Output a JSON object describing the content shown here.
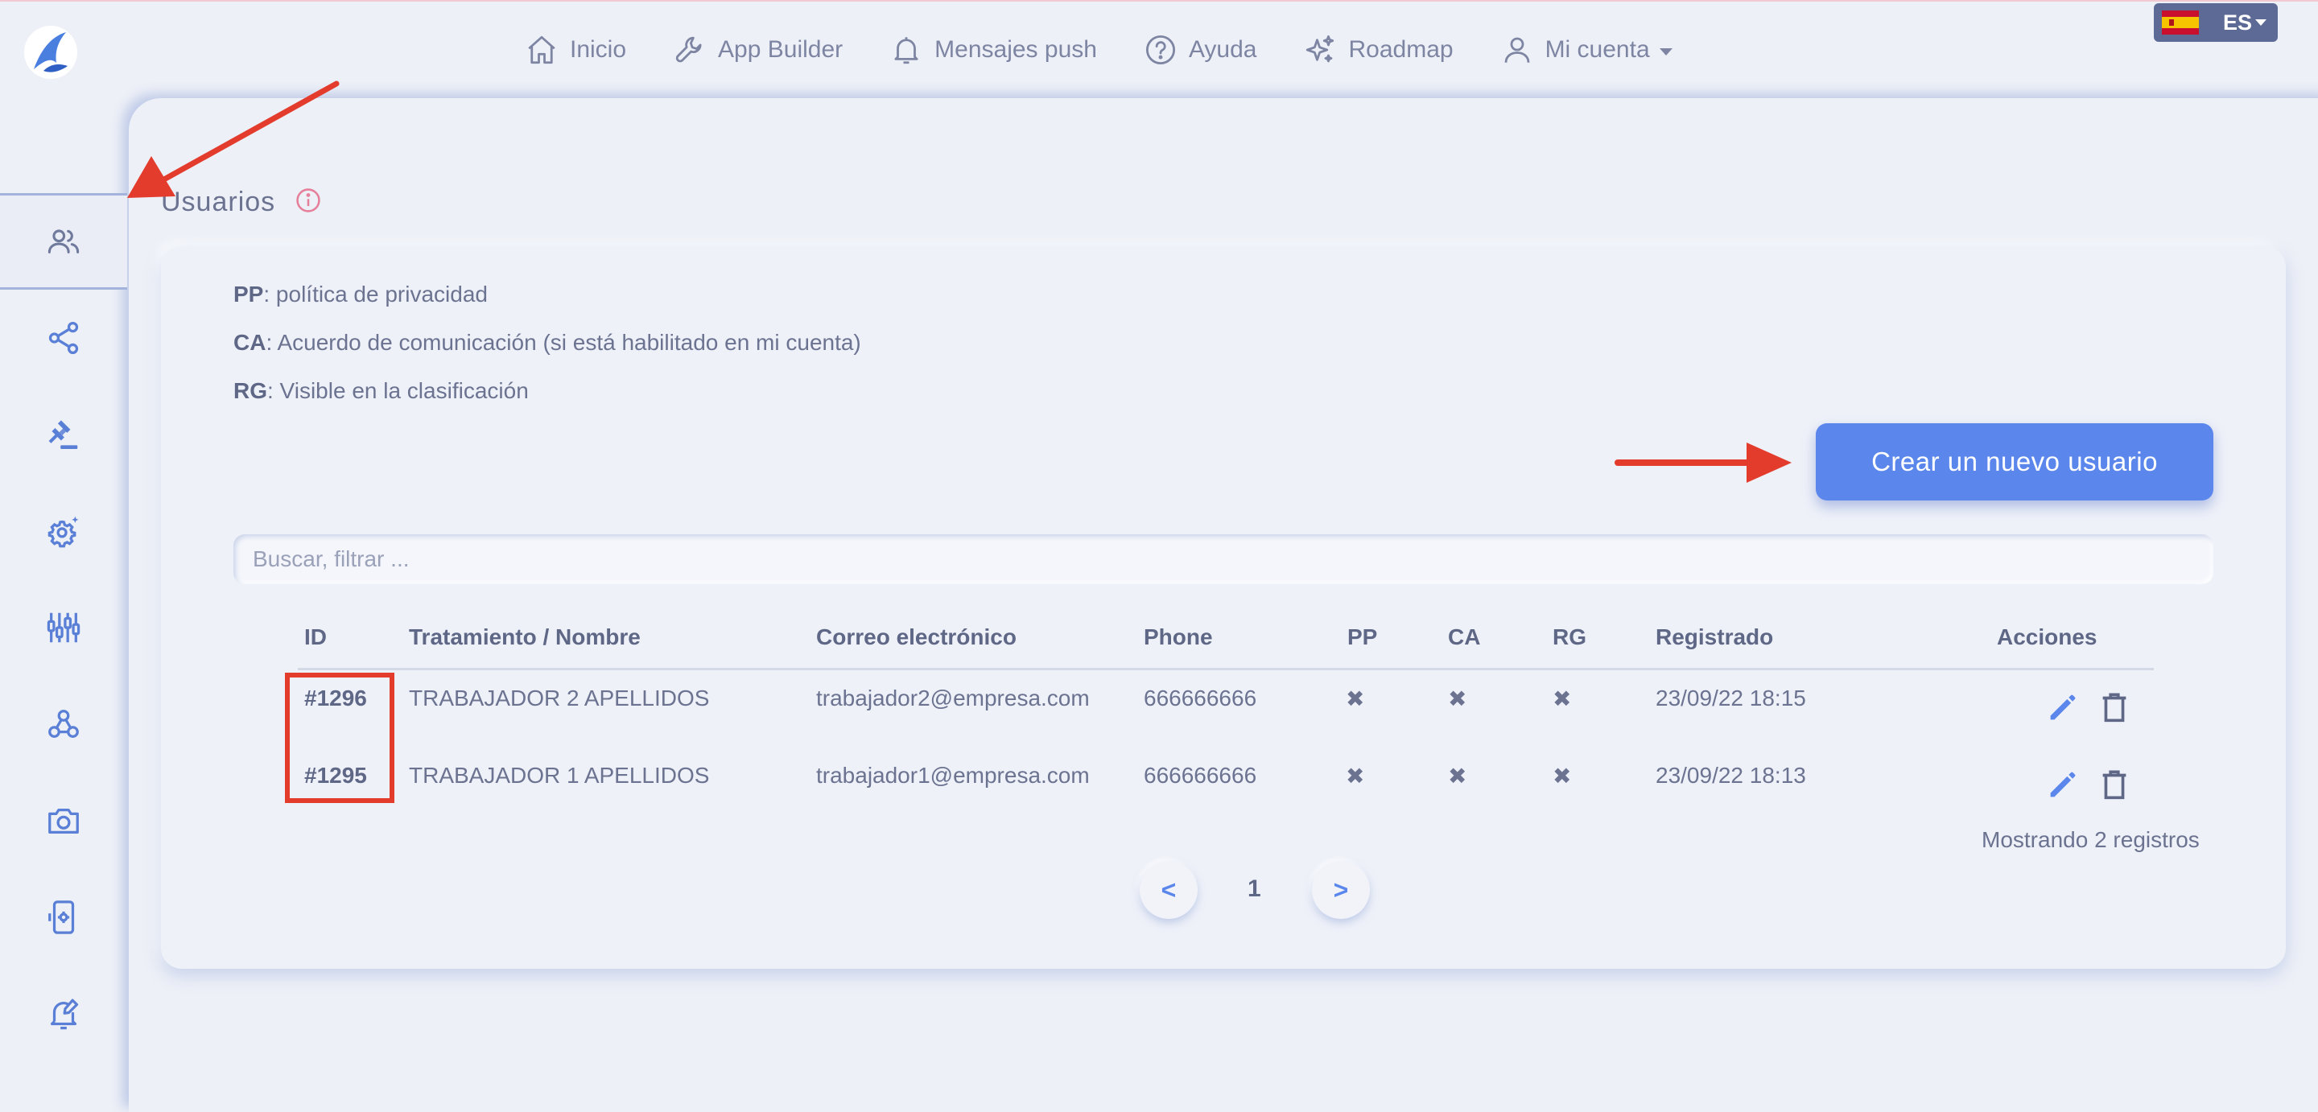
{
  "nav": {
    "items": [
      {
        "label": "Inicio",
        "icon": "home-icon"
      },
      {
        "label": "App Builder",
        "icon": "wrench-icon"
      },
      {
        "label": "Mensajes push",
        "icon": "bell-icon"
      },
      {
        "label": "Ayuda",
        "icon": "help-circle-icon"
      },
      {
        "label": "Roadmap",
        "icon": "sparkles-icon"
      },
      {
        "label": "Mi cuenta",
        "icon": "user-icon"
      }
    ],
    "language": "ES"
  },
  "sidebar": {
    "items": [
      {
        "icon": "users-icon",
        "active": true
      },
      {
        "icon": "share-icon"
      },
      {
        "icon": "gavel-icon"
      },
      {
        "icon": "gear-sparkle-icon"
      },
      {
        "icon": "sliders-icon"
      },
      {
        "icon": "webhook-icon"
      },
      {
        "icon": "camera-icon"
      },
      {
        "icon": "phone-settings-icon"
      },
      {
        "icon": "bell-edit-icon"
      }
    ]
  },
  "page": {
    "title": "Usuarios"
  },
  "legend": [
    {
      "abbr": "PP",
      "text": ": política de privacidad"
    },
    {
      "abbr": "CA",
      "text": ": Acuerdo de comunicación (si está habilitado en mi cuenta)"
    },
    {
      "abbr": "RG",
      "text": ": Visible en la clasificación"
    }
  ],
  "create_button": "Crear un nuevo usuario",
  "search": {
    "placeholder": "Buscar, filtrar ...",
    "value": ""
  },
  "table": {
    "columns": [
      "ID",
      "Tratamiento / Nombre",
      "Correo electrónico",
      "Phone",
      "PP",
      "CA",
      "RG",
      "Registrado",
      "Acciones"
    ],
    "rows": [
      {
        "id": "#1296",
        "name": "TRABAJADOR 2 APELLIDOS",
        "email": "trabajador2@empresa.com",
        "phone": "666666666",
        "pp": "✖",
        "ca": "✖",
        "rg": "✖",
        "registered": "23/09/22 18:15"
      },
      {
        "id": "#1295",
        "name": "TRABAJADOR 1 APELLIDOS",
        "email": "trabajador1@empresa.com",
        "phone": "666666666",
        "pp": "✖",
        "ca": "✖",
        "rg": "✖",
        "registered": "23/09/22 18:13"
      }
    ]
  },
  "records_text": "Mostrando 2 registros",
  "pagination": {
    "prev": "<",
    "current": "1",
    "next": ">"
  },
  "colors": {
    "accent": "#5b86ec",
    "annotation": "#e33c2d",
    "background": "#edf0f7"
  }
}
